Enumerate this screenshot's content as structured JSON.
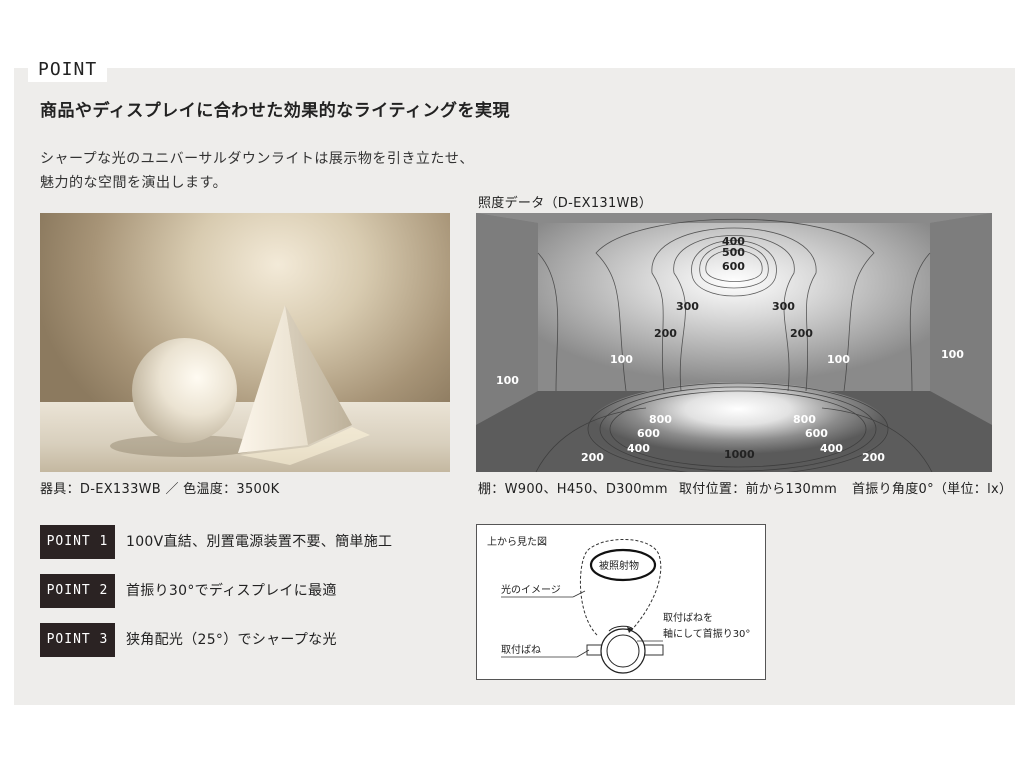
{
  "section_label": "POINT",
  "headline": "商品やディスプレイに合わせた効果的なライティングを実現",
  "description": {
    "line1": "シャープな光のユニバーサルダウンライトは展示物を引き立たせ、",
    "line2": "魅力的な空間を演出します。"
  },
  "photo_caption": "器具：D-EX133WB ／ 色温度：3500K",
  "isochart": {
    "title": "照度データ（D-EX131WB）",
    "wall_labels": [
      "400",
      "500",
      "600",
      "300",
      "300",
      "200",
      "200",
      "100",
      "100",
      "100",
      "100"
    ],
    "floor_labels": [
      "800",
      "600",
      "400",
      "800",
      "600",
      "400",
      "1000",
      "200",
      "200"
    ],
    "caption_shelf": "棚：W900、H450、D300mm",
    "caption_position": "取付位置：前から130mm",
    "caption_tilt": "首振り角度0°（単位：lx）"
  },
  "points": [
    {
      "badge": "POINT 1",
      "text": "100V直結、別置電源装置不要、簡単施工"
    },
    {
      "badge": "POINT 2",
      "text": "首振り30°でディスプレイに最適"
    },
    {
      "badge": "POINT 3",
      "text": "狭角配光（25°）でシャープな光"
    }
  ],
  "diagram": {
    "title": "上から見た図",
    "target": "被照射物",
    "light_image": "光のイメージ",
    "spring_note_line1": "取付ばねを",
    "spring_note_line2": "軸にして首振り30°",
    "spring": "取付ばね"
  },
  "colors": {
    "panel_bg": "#eeedeb",
    "badge_bg": "#2b2323",
    "wall_gray": "#8f8f8f"
  }
}
